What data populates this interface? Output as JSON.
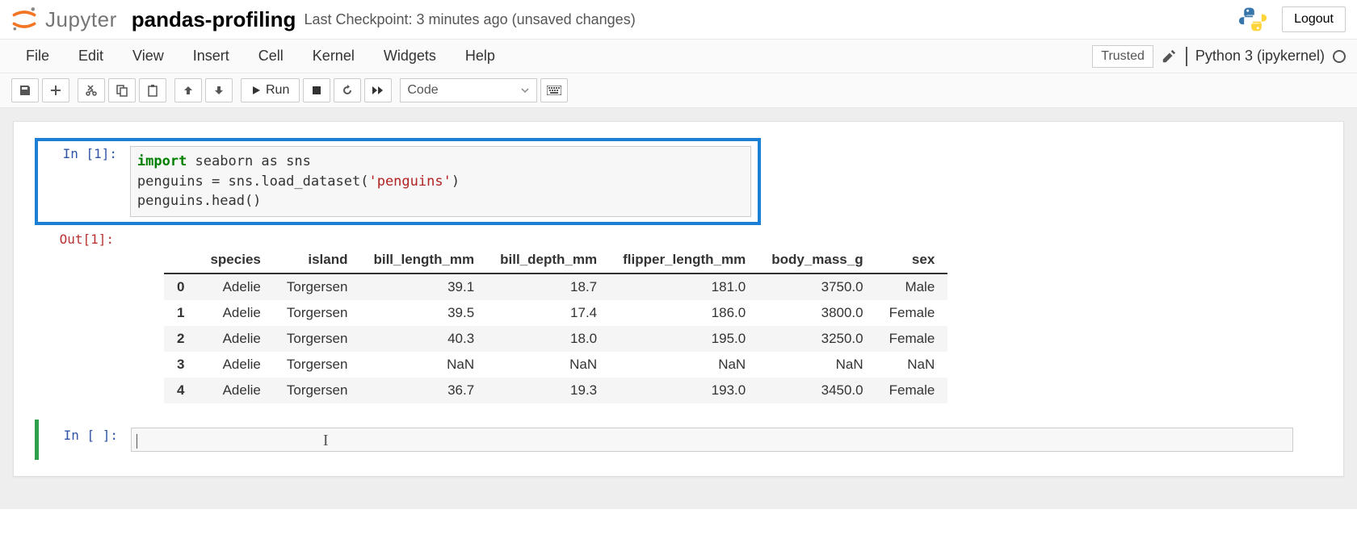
{
  "header": {
    "brand": "Jupyter",
    "notebook_title": "pandas-profiling",
    "checkpoint_text": "Last Checkpoint: 3 minutes ago  (unsaved changes)",
    "logout_label": "Logout"
  },
  "menubar": {
    "items": [
      "File",
      "Edit",
      "View",
      "Insert",
      "Cell",
      "Kernel",
      "Widgets",
      "Help"
    ],
    "trusted_label": "Trusted",
    "kernel_name": "Python 3 (ipykernel)"
  },
  "toolbar": {
    "run_label": "Run",
    "cell_type_value": "Code"
  },
  "cells": {
    "cell1": {
      "in_prompt": "In [1]:",
      "out_prompt": "Out[1]:",
      "code_line1_kw": "import",
      "code_line1_rest": " seaborn as sns",
      "code_line2_a": "penguins = sns.load_dataset(",
      "code_line2_str": "'penguins'",
      "code_line2_b": ")",
      "code_line3": "penguins.head()"
    },
    "cell2": {
      "in_prompt": "In [ ]:"
    }
  },
  "chart_data": {
    "type": "table",
    "columns": [
      "species",
      "island",
      "bill_length_mm",
      "bill_depth_mm",
      "flipper_length_mm",
      "body_mass_g",
      "sex"
    ],
    "index": [
      "0",
      "1",
      "2",
      "3",
      "4"
    ],
    "rows": [
      [
        "Adelie",
        "Torgersen",
        "39.1",
        "18.7",
        "181.0",
        "3750.0",
        "Male"
      ],
      [
        "Adelie",
        "Torgersen",
        "39.5",
        "17.4",
        "186.0",
        "3800.0",
        "Female"
      ],
      [
        "Adelie",
        "Torgersen",
        "40.3",
        "18.0",
        "195.0",
        "3250.0",
        "Female"
      ],
      [
        "Adelie",
        "Torgersen",
        "NaN",
        "NaN",
        "NaN",
        "NaN",
        "NaN"
      ],
      [
        "Adelie",
        "Torgersen",
        "36.7",
        "19.3",
        "193.0",
        "3450.0",
        "Female"
      ]
    ]
  }
}
